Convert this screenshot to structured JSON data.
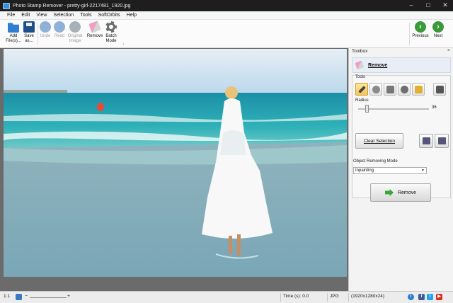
{
  "window": {
    "title": "Photo Stamp Remover - pretty-girl-2217481_1920.jpg",
    "controls": [
      "–",
      "□",
      "✕"
    ]
  },
  "menu": [
    "File",
    "Edit",
    "View",
    "Selection",
    "Tools",
    "SoftOrbits",
    "Help"
  ],
  "toolbar": {
    "add_files": "Add File(s)...",
    "save_as": "Save as...",
    "undo": "Undo",
    "redo": "Redo",
    "original_image": "Original Image",
    "remove": "Remove",
    "batch_mode": "Batch Mode",
    "previous": "Previous",
    "next": "Next"
  },
  "toolbox": {
    "title": "Toolbox",
    "close": "×",
    "tool_name": "Remove",
    "tools_label": "Tools",
    "radius_label": "Radius",
    "radius_value": "36",
    "radius_fraction": 0.12,
    "clear_selection": "Clear Selection",
    "mode_label": "Object Removing Mode",
    "mode_value": "Inpainting",
    "remove_button": "Remove"
  },
  "status": {
    "zoom_ratio": "1:1",
    "time": "Time (s): 0.0",
    "format": "JPG",
    "dimensions": "(1920x1280x24)",
    "info": "i",
    "facebook": "f",
    "twitter": "t",
    "youtube": "▶"
  },
  "colors": {
    "accent_green": "#3a9a3a",
    "selection_orange": "#f5c55a",
    "sea": "#2aa7b3",
    "sky": "#bfe0f2"
  }
}
